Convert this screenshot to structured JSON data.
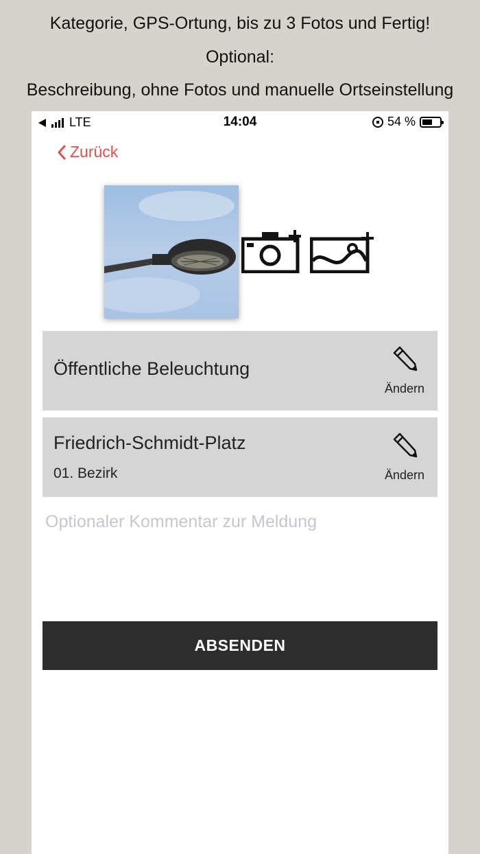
{
  "captions": {
    "line1": "Kategorie, GPS-Ortung, bis zu 3 Fotos und Fertig!",
    "line2": "Optional:",
    "line3": "Beschreibung, ohne Fotos und manuelle Ortseinstellung"
  },
  "status_bar": {
    "network": "LTE",
    "time": "14:04",
    "battery": "54 %"
  },
  "nav": {
    "back_label": "Zurück"
  },
  "photos": {
    "add_camera_icon": "camera-plus-icon",
    "add_gallery_icon": "image-plus-icon"
  },
  "category": {
    "title": "Öffentliche Beleuchtung",
    "edit_label": "Ändern"
  },
  "location": {
    "street": "Friedrich-Schmidt-Platz",
    "district": "01. Bezirk",
    "edit_label": "Ändern"
  },
  "comment": {
    "placeholder": "Optionaler Kommentar zur Meldung",
    "value": ""
  },
  "submit": {
    "label": "ABSENDEN"
  },
  "colors": {
    "accent": "#e0504e",
    "card_bg": "#d5d5d5",
    "button_bg": "#2d2d2d",
    "frame_bg": "#d6d2cc"
  }
}
